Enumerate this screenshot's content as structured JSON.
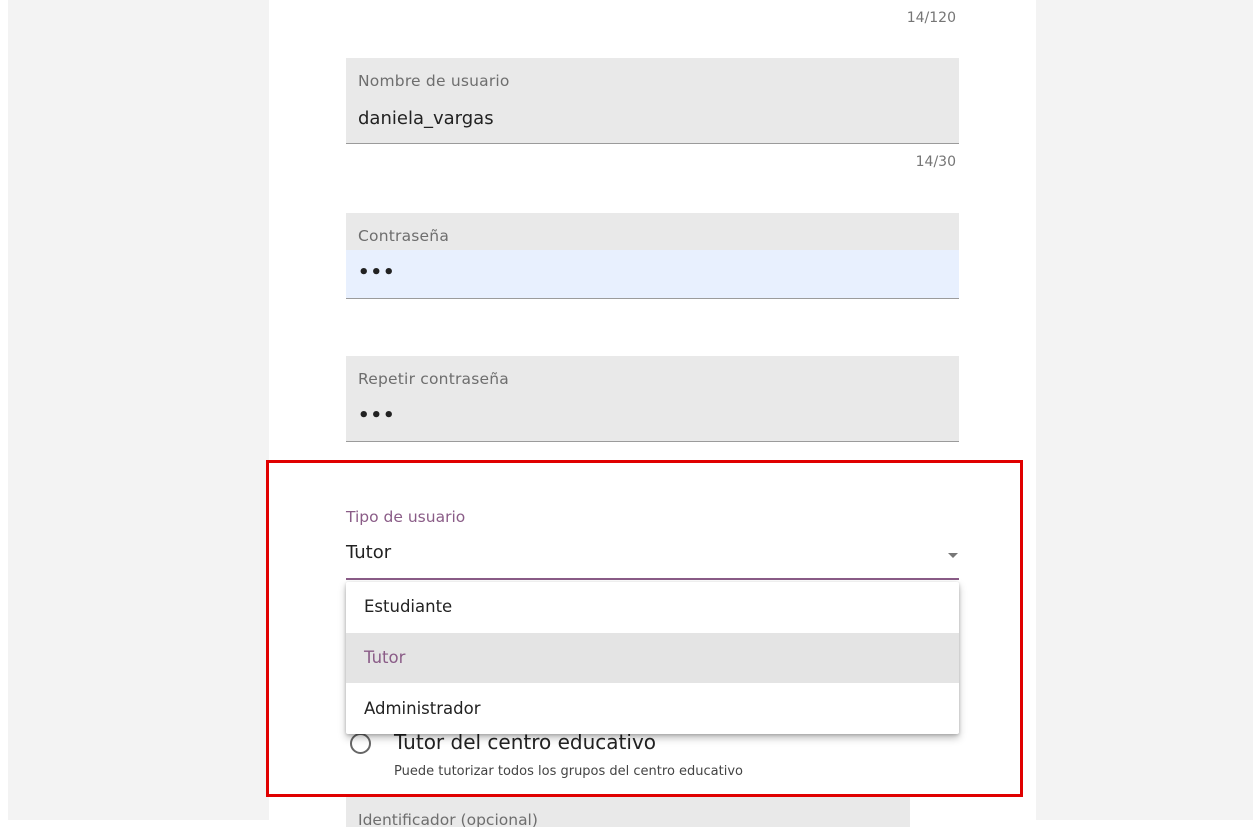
{
  "form": {
    "first_counter": "14/120",
    "username": {
      "label": "Nombre de usuario",
      "value": "daniela_vargas",
      "counter": "14/30"
    },
    "password": {
      "label": "Contraseña",
      "value": "•••"
    },
    "repeat_password": {
      "label": "Repetir contraseña",
      "value": "•••"
    },
    "user_type": {
      "label": "Tipo de usuario",
      "value": "Tutor",
      "options": [
        "Estudiante",
        "Tutor",
        "Administrador"
      ],
      "selected_option": "Tutor"
    },
    "radio_tutor_centro": {
      "label": "Tutor del centro educativo",
      "hint": "Puede tutorizar todos los grupos del centro educativo"
    },
    "identifier": {
      "label": "Identificador (opcional)"
    }
  },
  "colors": {
    "accent": "#8a5c87",
    "highlight_border": "#e00000",
    "field_bg": "#e9e9e9",
    "autofill_bg": "#e8f0fe",
    "page_side_bg": "#f3f3f3"
  },
  "icons": {
    "select_arrow": "caret-down-icon",
    "radio": "radio-unchecked-icon"
  }
}
